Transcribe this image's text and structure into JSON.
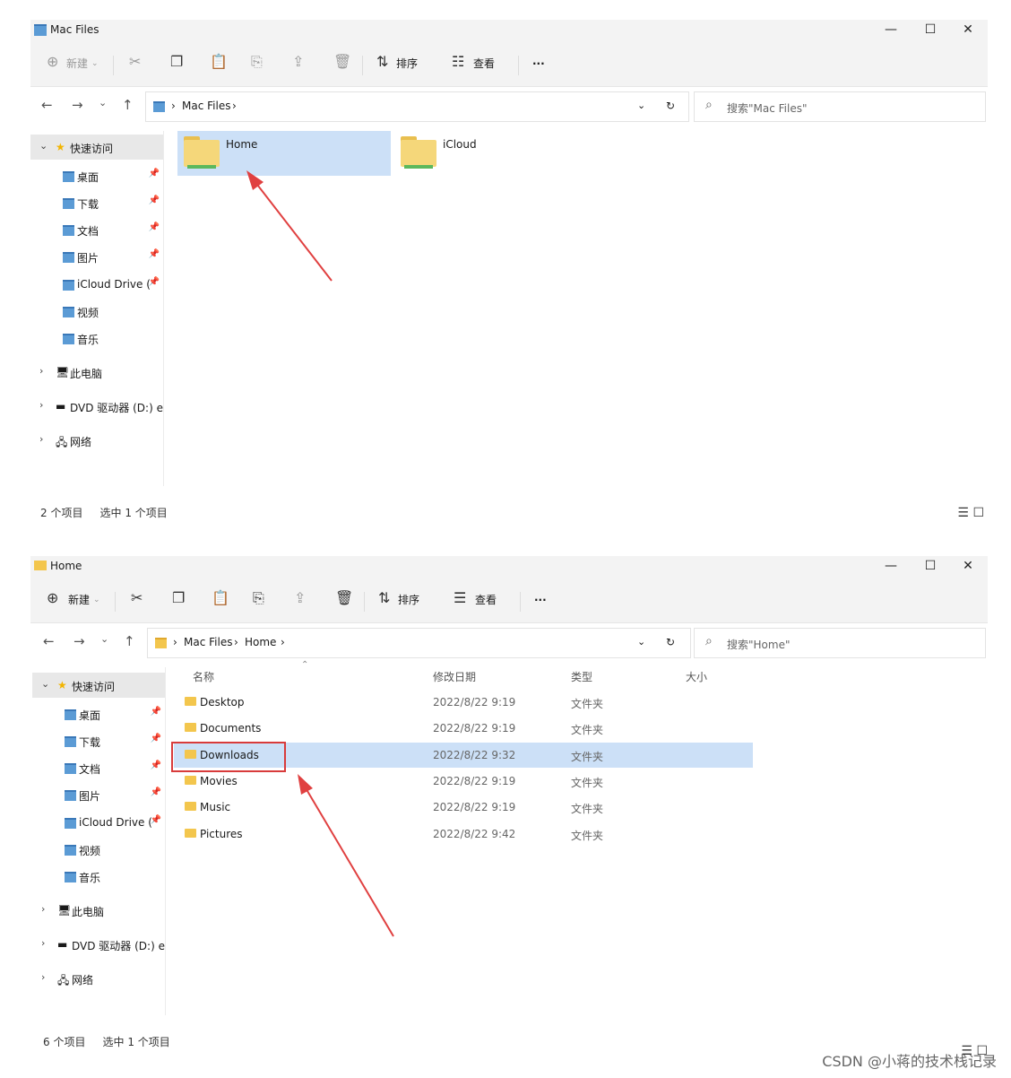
{
  "window1": {
    "title": "Mac Files",
    "toolbar": {
      "new": "新建",
      "sort": "排序",
      "view": "查看",
      "more": "···"
    },
    "breadcrumb": [
      "Mac Files"
    ],
    "search_placeholder": "搜索\"Mac Files\"",
    "sidebar": {
      "quick_access": "快速访问",
      "items": [
        "桌面",
        "下载",
        "文档",
        "图片",
        "iCloud Drive (M",
        "视频",
        "音乐"
      ],
      "this_pc": "此电脑",
      "dvd": "DVD 驱动器 (D:) esd",
      "network": "网络"
    },
    "folders": [
      "Home",
      "iCloud"
    ],
    "status": {
      "count": "2 个项目",
      "selected": "选中 1 个项目"
    }
  },
  "window2": {
    "title": "Home",
    "toolbar": {
      "new": "新建",
      "sort": "排序",
      "view": "查看",
      "more": "···"
    },
    "breadcrumb": [
      "Mac Files",
      "Home"
    ],
    "search_placeholder": "搜索\"Home\"",
    "sidebar": {
      "quick_access": "快速访问",
      "items": [
        "桌面",
        "下载",
        "文档",
        "图片",
        "iCloud Drive (M",
        "视频",
        "音乐"
      ],
      "this_pc": "此电脑",
      "dvd": "DVD 驱动器 (D:) esd",
      "network": "网络"
    },
    "columns": {
      "name": "名称",
      "date": "修改日期",
      "type": "类型",
      "size": "大小"
    },
    "rows": [
      {
        "name": "Desktop",
        "date": "2022/8/22 9:19",
        "type": "文件夹"
      },
      {
        "name": "Documents",
        "date": "2022/8/22 9:19",
        "type": "文件夹"
      },
      {
        "name": "Downloads",
        "date": "2022/8/22 9:32",
        "type": "文件夹"
      },
      {
        "name": "Movies",
        "date": "2022/8/22 9:19",
        "type": "文件夹"
      },
      {
        "name": "Music",
        "date": "2022/8/22 9:19",
        "type": "文件夹"
      },
      {
        "name": "Pictures",
        "date": "2022/8/22 9:42",
        "type": "文件夹"
      }
    ],
    "status": {
      "count": "6 个项目",
      "selected": "选中 1 个项目"
    }
  },
  "watermark": "CSDN @小蒋的技术栈记录",
  "colors": {
    "selection": "#cce0f7",
    "highlight_box": "#d83b3b",
    "arrow": "#e04040",
    "folder": "#f3c64d"
  }
}
